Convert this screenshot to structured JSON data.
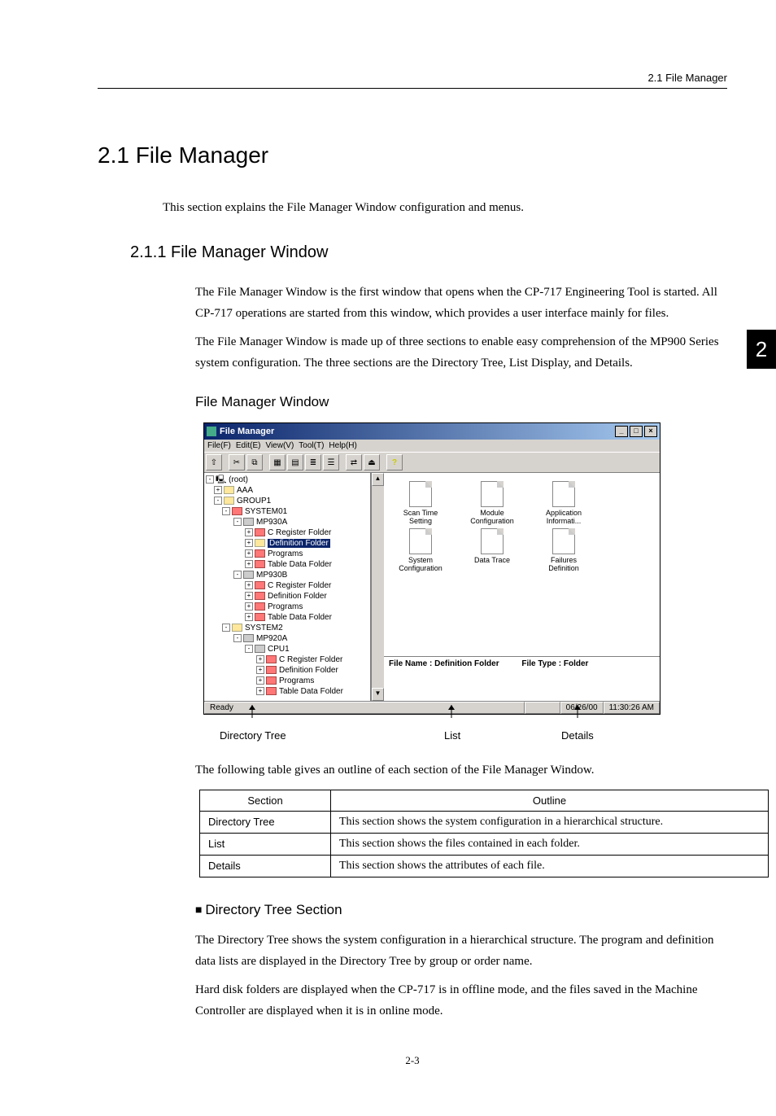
{
  "header": {
    "running": "2.1  File Manager"
  },
  "side_tab": "2",
  "h1": "2.1  File Manager",
  "intro": "This section explains the File Manager Window configuration and menus.",
  "h2": "2.1.1  File Manager Window",
  "para1": "The File Manager Window is the first window that opens when the CP-717 Engineering Tool is started. All CP-717 operations are started from this window, which provides a user interface mainly for files.",
  "para2": "The File Manager Window is made up of three sections to enable easy comprehension of the MP900 Series system configuration. The three sections are the Directory Tree, List Display, and Details.",
  "h3": "File Manager Window",
  "window": {
    "title": "File Manager",
    "menu": [
      "File(F)",
      "Edit(E)",
      "View(V)",
      "Tool(T)",
      "Help(H)"
    ],
    "tree": {
      "root": "(root)",
      "items": [
        {
          "lvl": 1,
          "exp": "+",
          "label": "AAA"
        },
        {
          "lvl": 1,
          "exp": "-",
          "label": "GROUP1"
        },
        {
          "lvl": 2,
          "exp": "-",
          "label": "SYSTEM01",
          "red": true
        },
        {
          "lvl": 3,
          "exp": "-",
          "label": "MP930A",
          "cpu": true
        },
        {
          "lvl": 4,
          "exp": "+",
          "label": "C Register Folder",
          "red": true
        },
        {
          "lvl": 4,
          "exp": "+",
          "label": "Definition Folder",
          "sel": true
        },
        {
          "lvl": 4,
          "exp": "+",
          "label": "Programs",
          "red": true
        },
        {
          "lvl": 4,
          "exp": "+",
          "label": "Table Data Folder",
          "red": true
        },
        {
          "lvl": 3,
          "exp": "-",
          "label": "MP930B",
          "cpu": true
        },
        {
          "lvl": 4,
          "exp": "+",
          "label": "C Register Folder",
          "red": true
        },
        {
          "lvl": 4,
          "exp": "+",
          "label": "Definition Folder",
          "red": true
        },
        {
          "lvl": 4,
          "exp": "+",
          "label": "Programs",
          "red": true
        },
        {
          "lvl": 4,
          "exp": "+",
          "label": "Table Data Folder",
          "red": true
        },
        {
          "lvl": 2,
          "exp": "-",
          "label": "SYSTEM2"
        },
        {
          "lvl": 3,
          "exp": "-",
          "label": "MP920A",
          "cpu": true
        },
        {
          "lvl": 4,
          "exp": "-",
          "label": "CPU1",
          "cpu": true
        },
        {
          "lvl": 5,
          "exp": "+",
          "label": "C Register Folder",
          "red": true
        },
        {
          "lvl": 5,
          "exp": "+",
          "label": "Definition Folder",
          "red": true
        },
        {
          "lvl": 5,
          "exp": "+",
          "label": "Programs",
          "red": true
        },
        {
          "lvl": 5,
          "exp": "+",
          "label": "Table Data Folder",
          "red": true
        }
      ]
    },
    "list": [
      "Scan Time Setting",
      "Module Configuration",
      "Application Informati...",
      "System Configuration",
      "Data Trace",
      "Failures Definition"
    ],
    "details": {
      "name_label": "File Name :",
      "name_value": "Definition Folder",
      "type_label": "File Type :",
      "type_value": "Folder"
    },
    "status": {
      "ready": "Ready",
      "date": "06/26/00",
      "time": "11:30:26 AM"
    }
  },
  "callouts": {
    "c1": "Directory Tree",
    "c2": "List",
    "c3": "Details"
  },
  "outline_intro": "The following table gives an outline of each section of the File Manager Window.",
  "table": {
    "headers": [
      "Section",
      "Outline"
    ],
    "rows": [
      [
        "Directory Tree",
        "This section shows the system configuration in a hierarchical structure."
      ],
      [
        "List",
        "This section shows the files contained in each folder."
      ],
      [
        "Details",
        "This section shows the attributes of each file."
      ]
    ]
  },
  "bullet_head": "Directory Tree Section",
  "para3": "The Directory Tree shows the system configuration in a hierarchical structure. The program and definition data lists are displayed in the Directory Tree by group or order name.",
  "para4": "Hard disk folders are displayed when the CP-717 is in offline mode, and the files saved in the Machine Controller are displayed when it is in online mode.",
  "footer": "2-3"
}
